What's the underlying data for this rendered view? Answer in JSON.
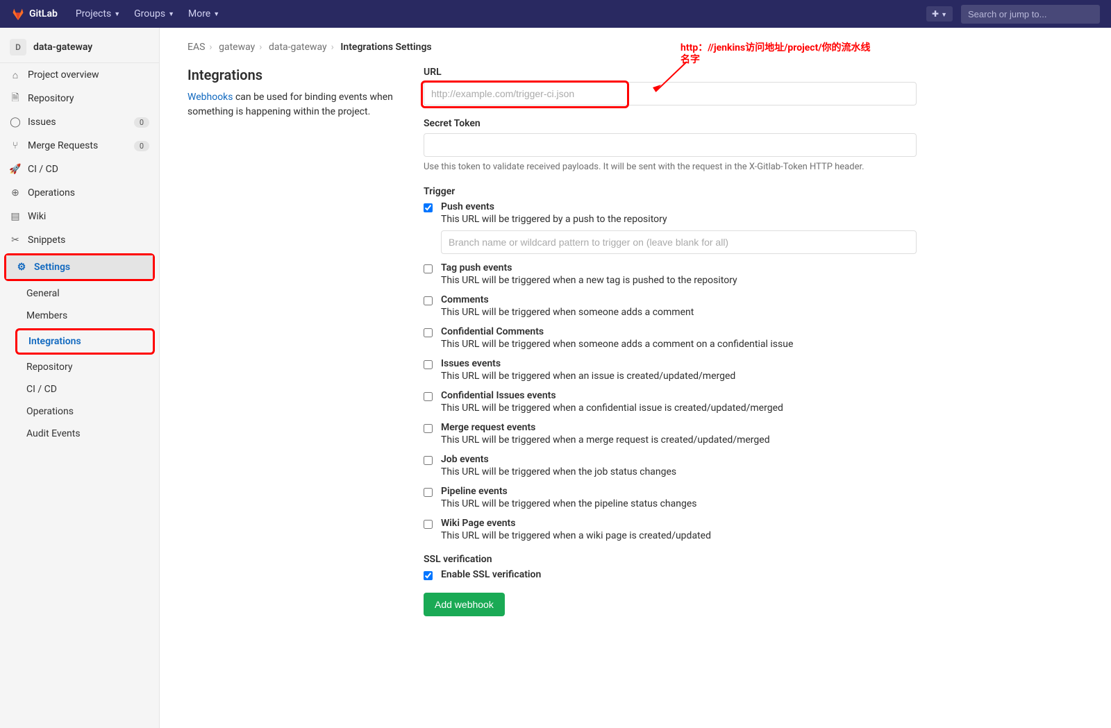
{
  "topbar": {
    "brand": "GitLab",
    "nav": [
      "Projects",
      "Groups",
      "More"
    ],
    "search_placeholder": "Search or jump to..."
  },
  "project": {
    "initial": "D",
    "name": "data-gateway"
  },
  "sidebar": {
    "items": [
      {
        "label": "Project overview"
      },
      {
        "label": "Repository"
      },
      {
        "label": "Issues",
        "badge": "0"
      },
      {
        "label": "Merge Requests",
        "badge": "0"
      },
      {
        "label": "CI / CD"
      },
      {
        "label": "Operations"
      },
      {
        "label": "Wiki"
      },
      {
        "label": "Snippets"
      },
      {
        "label": "Settings"
      }
    ],
    "sub": [
      "General",
      "Members",
      "Integrations",
      "Repository",
      "CI / CD",
      "Operations",
      "Audit Events"
    ]
  },
  "breadcrumb": {
    "a": "EAS",
    "b": "gateway",
    "c": "data-gateway",
    "d": "Integrations Settings"
  },
  "intro": {
    "title": "Integrations",
    "link": "Webhooks",
    "text": " can be used for binding events when something is happening within the project."
  },
  "form": {
    "url_label": "URL",
    "url_placeholder": "http://example.com/trigger-ci.json",
    "secret_label": "Secret Token",
    "secret_help": "Use this token to validate received payloads. It will be sent with the request in the X-Gitlab-Token HTTP header.",
    "trigger_label": "Trigger",
    "ssl_label": "SSL verification",
    "ssl_check": "Enable SSL verification",
    "submit": "Add webhook",
    "branch_placeholder": "Branch name or wildcard pattern to trigger on (leave blank for all)"
  },
  "triggers": [
    {
      "title": "Push events",
      "desc": "This URL will be triggered by a push to the repository",
      "checked": true,
      "branch": true
    },
    {
      "title": "Tag push events",
      "desc": "This URL will be triggered when a new tag is pushed to the repository"
    },
    {
      "title": "Comments",
      "desc": "This URL will be triggered when someone adds a comment"
    },
    {
      "title": "Confidential Comments",
      "desc": "This URL will be triggered when someone adds a comment on a confidential issue"
    },
    {
      "title": "Issues events",
      "desc": "This URL will be triggered when an issue is created/updated/merged"
    },
    {
      "title": "Confidential Issues events",
      "desc": "This URL will be triggered when a confidential issue is created/updated/merged"
    },
    {
      "title": "Merge request events",
      "desc": "This URL will be triggered when a merge request is created/updated/merged"
    },
    {
      "title": "Job events",
      "desc": "This URL will be triggered when the job status changes"
    },
    {
      "title": "Pipeline events",
      "desc": "This URL will be triggered when the pipeline status changes"
    },
    {
      "title": "Wiki Page events",
      "desc": "This URL will be triggered when a wiki page is created/updated"
    }
  ],
  "annotation": {
    "line1": "http：//jenkins访问地址/project/你的流水线",
    "line2": "名字"
  }
}
